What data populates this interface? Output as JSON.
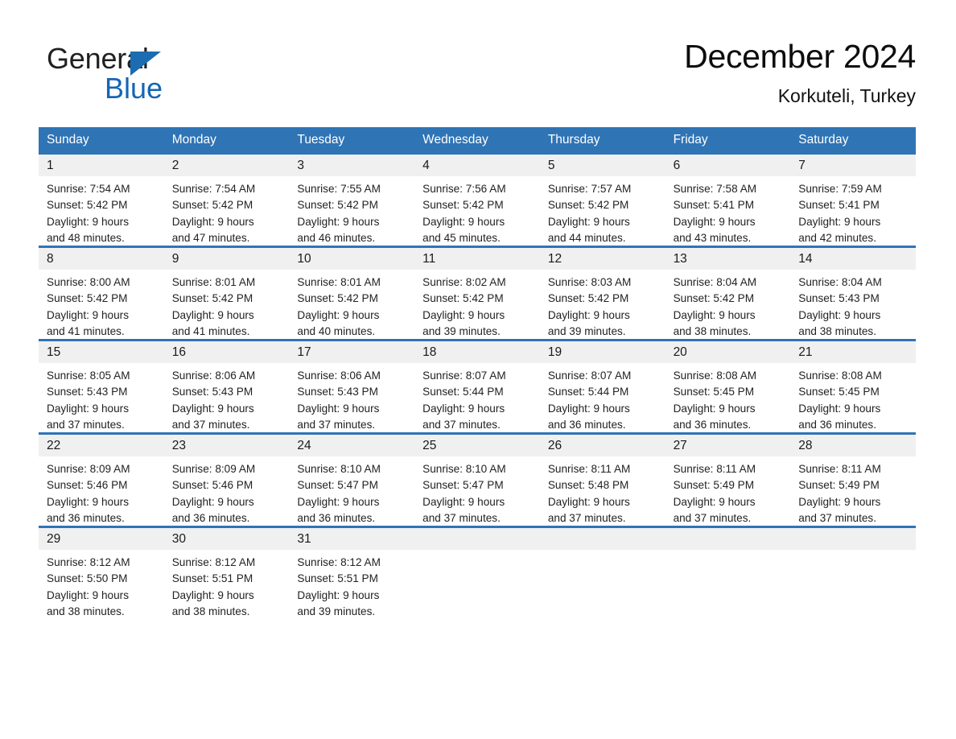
{
  "brand": {
    "name_part1": "General",
    "name_part2": "Blue",
    "triangle_color": "#1b6cb0",
    "blue_color": "#1566b5"
  },
  "header": {
    "title": "December 2024",
    "subtitle": "Korkuteli, Turkey"
  },
  "theme": {
    "header_blue": "#2f74b5",
    "daynum_band": "#f0f0f0",
    "rule_blue": "#2f74b5"
  },
  "weekdays": [
    "Sunday",
    "Monday",
    "Tuesday",
    "Wednesday",
    "Thursday",
    "Friday",
    "Saturday"
  ],
  "weeks": [
    {
      "days": [
        {
          "num": "1",
          "sunrise": "Sunrise: 7:54 AM",
          "sunset": "Sunset: 5:42 PM",
          "daylight1": "Daylight: 9 hours",
          "daylight2": "and 48 minutes."
        },
        {
          "num": "2",
          "sunrise": "Sunrise: 7:54 AM",
          "sunset": "Sunset: 5:42 PM",
          "daylight1": "Daylight: 9 hours",
          "daylight2": "and 47 minutes."
        },
        {
          "num": "3",
          "sunrise": "Sunrise: 7:55 AM",
          "sunset": "Sunset: 5:42 PM",
          "daylight1": "Daylight: 9 hours",
          "daylight2": "and 46 minutes."
        },
        {
          "num": "4",
          "sunrise": "Sunrise: 7:56 AM",
          "sunset": "Sunset: 5:42 PM",
          "daylight1": "Daylight: 9 hours",
          "daylight2": "and 45 minutes."
        },
        {
          "num": "5",
          "sunrise": "Sunrise: 7:57 AM",
          "sunset": "Sunset: 5:42 PM",
          "daylight1": "Daylight: 9 hours",
          "daylight2": "and 44 minutes."
        },
        {
          "num": "6",
          "sunrise": "Sunrise: 7:58 AM",
          "sunset": "Sunset: 5:41 PM",
          "daylight1": "Daylight: 9 hours",
          "daylight2": "and 43 minutes."
        },
        {
          "num": "7",
          "sunrise": "Sunrise: 7:59 AM",
          "sunset": "Sunset: 5:41 PM",
          "daylight1": "Daylight: 9 hours",
          "daylight2": "and 42 minutes."
        }
      ]
    },
    {
      "days": [
        {
          "num": "8",
          "sunrise": "Sunrise: 8:00 AM",
          "sunset": "Sunset: 5:42 PM",
          "daylight1": "Daylight: 9 hours",
          "daylight2": "and 41 minutes."
        },
        {
          "num": "9",
          "sunrise": "Sunrise: 8:01 AM",
          "sunset": "Sunset: 5:42 PM",
          "daylight1": "Daylight: 9 hours",
          "daylight2": "and 41 minutes."
        },
        {
          "num": "10",
          "sunrise": "Sunrise: 8:01 AM",
          "sunset": "Sunset: 5:42 PM",
          "daylight1": "Daylight: 9 hours",
          "daylight2": "and 40 minutes."
        },
        {
          "num": "11",
          "sunrise": "Sunrise: 8:02 AM",
          "sunset": "Sunset: 5:42 PM",
          "daylight1": "Daylight: 9 hours",
          "daylight2": "and 39 minutes."
        },
        {
          "num": "12",
          "sunrise": "Sunrise: 8:03 AM",
          "sunset": "Sunset: 5:42 PM",
          "daylight1": "Daylight: 9 hours",
          "daylight2": "and 39 minutes."
        },
        {
          "num": "13",
          "sunrise": "Sunrise: 8:04 AM",
          "sunset": "Sunset: 5:42 PM",
          "daylight1": "Daylight: 9 hours",
          "daylight2": "and 38 minutes."
        },
        {
          "num": "14",
          "sunrise": "Sunrise: 8:04 AM",
          "sunset": "Sunset: 5:43 PM",
          "daylight1": "Daylight: 9 hours",
          "daylight2": "and 38 minutes."
        }
      ]
    },
    {
      "days": [
        {
          "num": "15",
          "sunrise": "Sunrise: 8:05 AM",
          "sunset": "Sunset: 5:43 PM",
          "daylight1": "Daylight: 9 hours",
          "daylight2": "and 37 minutes."
        },
        {
          "num": "16",
          "sunrise": "Sunrise: 8:06 AM",
          "sunset": "Sunset: 5:43 PM",
          "daylight1": "Daylight: 9 hours",
          "daylight2": "and 37 minutes."
        },
        {
          "num": "17",
          "sunrise": "Sunrise: 8:06 AM",
          "sunset": "Sunset: 5:43 PM",
          "daylight1": "Daylight: 9 hours",
          "daylight2": "and 37 minutes."
        },
        {
          "num": "18",
          "sunrise": "Sunrise: 8:07 AM",
          "sunset": "Sunset: 5:44 PM",
          "daylight1": "Daylight: 9 hours",
          "daylight2": "and 37 minutes."
        },
        {
          "num": "19",
          "sunrise": "Sunrise: 8:07 AM",
          "sunset": "Sunset: 5:44 PM",
          "daylight1": "Daylight: 9 hours",
          "daylight2": "and 36 minutes."
        },
        {
          "num": "20",
          "sunrise": "Sunrise: 8:08 AM",
          "sunset": "Sunset: 5:45 PM",
          "daylight1": "Daylight: 9 hours",
          "daylight2": "and 36 minutes."
        },
        {
          "num": "21",
          "sunrise": "Sunrise: 8:08 AM",
          "sunset": "Sunset: 5:45 PM",
          "daylight1": "Daylight: 9 hours",
          "daylight2": "and 36 minutes."
        }
      ]
    },
    {
      "days": [
        {
          "num": "22",
          "sunrise": "Sunrise: 8:09 AM",
          "sunset": "Sunset: 5:46 PM",
          "daylight1": "Daylight: 9 hours",
          "daylight2": "and 36 minutes."
        },
        {
          "num": "23",
          "sunrise": "Sunrise: 8:09 AM",
          "sunset": "Sunset: 5:46 PM",
          "daylight1": "Daylight: 9 hours",
          "daylight2": "and 36 minutes."
        },
        {
          "num": "24",
          "sunrise": "Sunrise: 8:10 AM",
          "sunset": "Sunset: 5:47 PM",
          "daylight1": "Daylight: 9 hours",
          "daylight2": "and 36 minutes."
        },
        {
          "num": "25",
          "sunrise": "Sunrise: 8:10 AM",
          "sunset": "Sunset: 5:47 PM",
          "daylight1": "Daylight: 9 hours",
          "daylight2": "and 37 minutes."
        },
        {
          "num": "26",
          "sunrise": "Sunrise: 8:11 AM",
          "sunset": "Sunset: 5:48 PM",
          "daylight1": "Daylight: 9 hours",
          "daylight2": "and 37 minutes."
        },
        {
          "num": "27",
          "sunrise": "Sunrise: 8:11 AM",
          "sunset": "Sunset: 5:49 PM",
          "daylight1": "Daylight: 9 hours",
          "daylight2": "and 37 minutes."
        },
        {
          "num": "28",
          "sunrise": "Sunrise: 8:11 AM",
          "sunset": "Sunset: 5:49 PM",
          "daylight1": "Daylight: 9 hours",
          "daylight2": "and 37 minutes."
        }
      ]
    },
    {
      "days": [
        {
          "num": "29",
          "sunrise": "Sunrise: 8:12 AM",
          "sunset": "Sunset: 5:50 PM",
          "daylight1": "Daylight: 9 hours",
          "daylight2": "and 38 minutes."
        },
        {
          "num": "30",
          "sunrise": "Sunrise: 8:12 AM",
          "sunset": "Sunset: 5:51 PM",
          "daylight1": "Daylight: 9 hours",
          "daylight2": "and 38 minutes."
        },
        {
          "num": "31",
          "sunrise": "Sunrise: 8:12 AM",
          "sunset": "Sunset: 5:51 PM",
          "daylight1": "Daylight: 9 hours",
          "daylight2": "and 39 minutes."
        },
        {
          "num": "",
          "sunrise": "",
          "sunset": "",
          "daylight1": "",
          "daylight2": ""
        },
        {
          "num": "",
          "sunrise": "",
          "sunset": "",
          "daylight1": "",
          "daylight2": ""
        },
        {
          "num": "",
          "sunrise": "",
          "sunset": "",
          "daylight1": "",
          "daylight2": ""
        },
        {
          "num": "",
          "sunrise": "",
          "sunset": "",
          "daylight1": "",
          "daylight2": ""
        }
      ]
    }
  ]
}
